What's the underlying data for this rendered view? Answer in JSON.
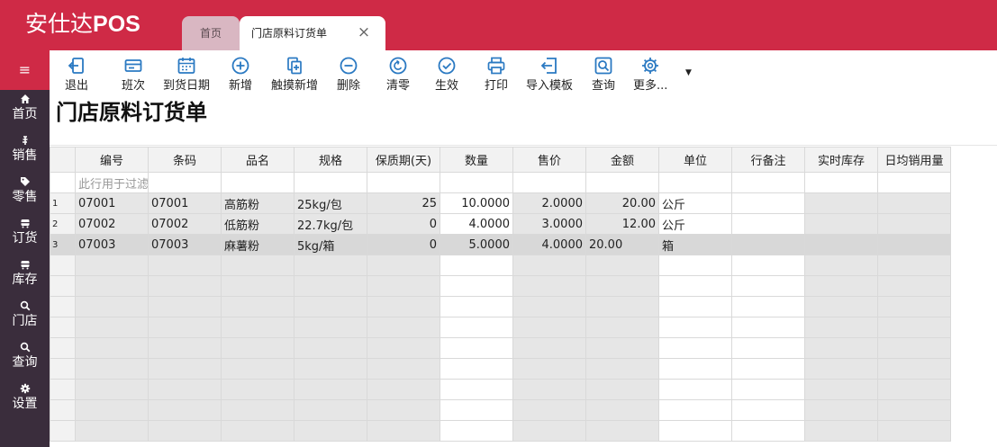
{
  "app": {
    "brand_cn": "安仕达",
    "brand_en": "POS"
  },
  "tabs": [
    {
      "label": "首页"
    },
    {
      "label": "门店原料订货单",
      "close": "×"
    }
  ],
  "sidebar": {
    "menu_icon": "≡",
    "items": [
      {
        "label": "首页",
        "icon": "home-icon"
      },
      {
        "label": "销售",
        "icon": "currency-icon"
      },
      {
        "label": "零售",
        "icon": "tag-icon"
      },
      {
        "label": "订货",
        "icon": "cart-icon"
      },
      {
        "label": "库存",
        "icon": "warehouse-icon"
      },
      {
        "label": "门店",
        "icon": "search-icon"
      },
      {
        "label": "查询",
        "icon": "search-icon"
      },
      {
        "label": "设置",
        "icon": "gear-icon"
      }
    ]
  },
  "toolbar": {
    "exit": "退出",
    "shift": "班次",
    "arrival_date": "到货日期",
    "add": "新增",
    "touch_add": "触摸新增",
    "delete": "删除",
    "clear": "清零",
    "confirm": "生效",
    "print": "打印",
    "import_template": "导入模板",
    "query": "查询",
    "more": "更多...",
    "accent": "#2a79c2"
  },
  "document": {
    "title": "门店原料订货单"
  },
  "grid": {
    "columns": [
      "编号",
      "条码",
      "品名",
      "规格",
      "保质期(天)",
      "数量",
      "售价",
      "金额",
      "单位",
      "行备注",
      "实时库存",
      "日均销用量"
    ],
    "filter_placeholder": "此行用于过滤",
    "rows": [
      {
        "no": "1",
        "code": "07001",
        "barcode": "07001",
        "name": "高筋粉",
        "spec": "25kg/包",
        "shelf_life": "25",
        "qty": "10.0000",
        "price": "2.0000",
        "amount": "20.00",
        "unit": "公斤"
      },
      {
        "no": "2",
        "code": "07002",
        "barcode": "07002",
        "name": "低筋粉",
        "spec": "22.7kg/包",
        "shelf_life": "0",
        "qty": "4.0000",
        "price": "3.0000",
        "amount": "12.00",
        "unit": "公斤"
      },
      {
        "no": "3",
        "code": "07003",
        "barcode": "07003",
        "name": "麻薯粉",
        "spec": "5kg/箱",
        "shelf_life": "0",
        "qty": "5.0000",
        "price": "4.0000",
        "amount": "20.00",
        "unit": "箱"
      }
    ]
  },
  "colors": {
    "brand_red": "#cf2a46",
    "sidebar_bg": "#3a2d3c",
    "tab_inactive": "#d9b7c2"
  }
}
